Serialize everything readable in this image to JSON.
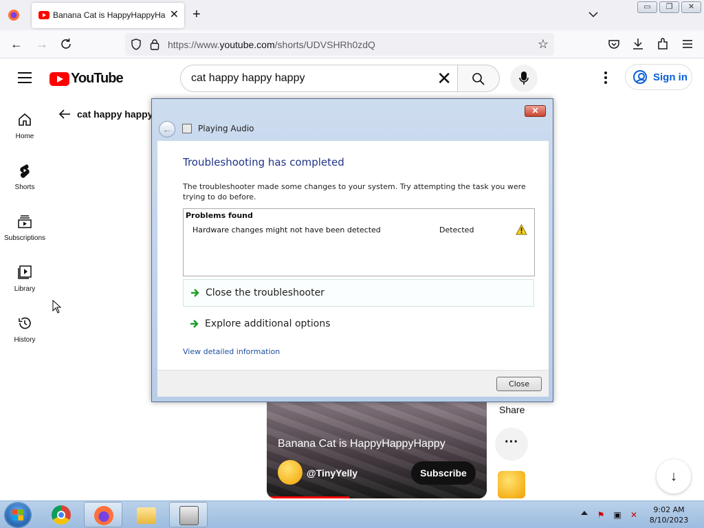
{
  "browser": {
    "tab_title": "Banana Cat is HappyHappyHappy",
    "tab_close": "✕",
    "new_tab": "+",
    "url_prefix": "https://www.",
    "url_host": "youtube.com",
    "url_path": "/shorts/UDVSHRh0zdQ",
    "window_buttons": [
      "▭",
      "❐",
      "✕"
    ]
  },
  "youtube": {
    "logo_text": "YouTube",
    "search_query": "cat happy happy happy",
    "signin_label": "Sign in",
    "sidebar": [
      {
        "label": "Home",
        "icon": "home-icon"
      },
      {
        "label": "Shorts",
        "icon": "shorts-icon"
      },
      {
        "label": "Subscriptions",
        "icon": "subscriptions-icon"
      },
      {
        "label": "Library",
        "icon": "library-icon"
      },
      {
        "label": "History",
        "icon": "history-icon"
      }
    ],
    "back_label": "cat happy happy h",
    "short": {
      "video_title": "Banana Cat is HappyHappyHappy",
      "channel": "@TinyYelly",
      "subscribe": "Subscribe"
    },
    "share_label": "Share",
    "more_label": "···",
    "down_label": "↓"
  },
  "dialog": {
    "title": "Playing Audio",
    "close_x": "✕",
    "back_arrow": "←",
    "heading": "Troubleshooting has completed",
    "description": "The troubleshooter made some changes to your system. Try attempting the task you were trying to do before.",
    "problems_header": "Problems found",
    "problem_name": "Hardware changes might not have been detected",
    "problem_status": "Detected",
    "option_close": "Close the troubleshooter",
    "option_explore": "Explore additional options",
    "details_link": "View detailed information",
    "close_button": "Close"
  },
  "taskbar": {
    "time": "9:02 AM",
    "date": "8/10/2023"
  },
  "colors": {
    "youtube_red": "#ff0000",
    "link_blue": "#065fd4",
    "dialog_heading": "#1e3287",
    "taskbar": "#b9d1ea"
  }
}
